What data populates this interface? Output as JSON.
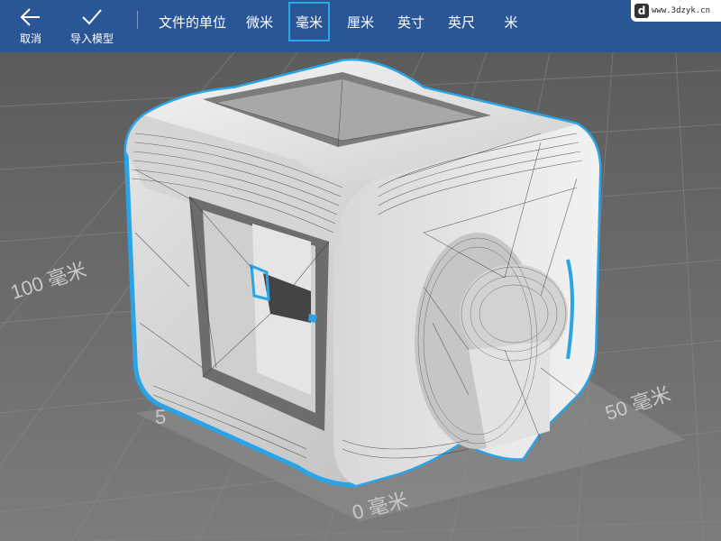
{
  "toolbar": {
    "cancel_label": "取消",
    "import_label": "导入模型",
    "units_title": "文件的单位",
    "units": [
      "微米",
      "毫米",
      "厘米",
      "英寸",
      "英尺",
      "米"
    ],
    "selected_unit": "毫米",
    "background_color": "#2b5696",
    "selection_color": "#29a7e8"
  },
  "scene": {
    "ruler_labels": [
      "100 毫米",
      "50 毫米",
      "0 毫米",
      "5"
    ],
    "model_outline_color": "#2aa4e6"
  },
  "watermark": {
    "url": "www.3dzyk.cn",
    "logo_letter": "d"
  }
}
